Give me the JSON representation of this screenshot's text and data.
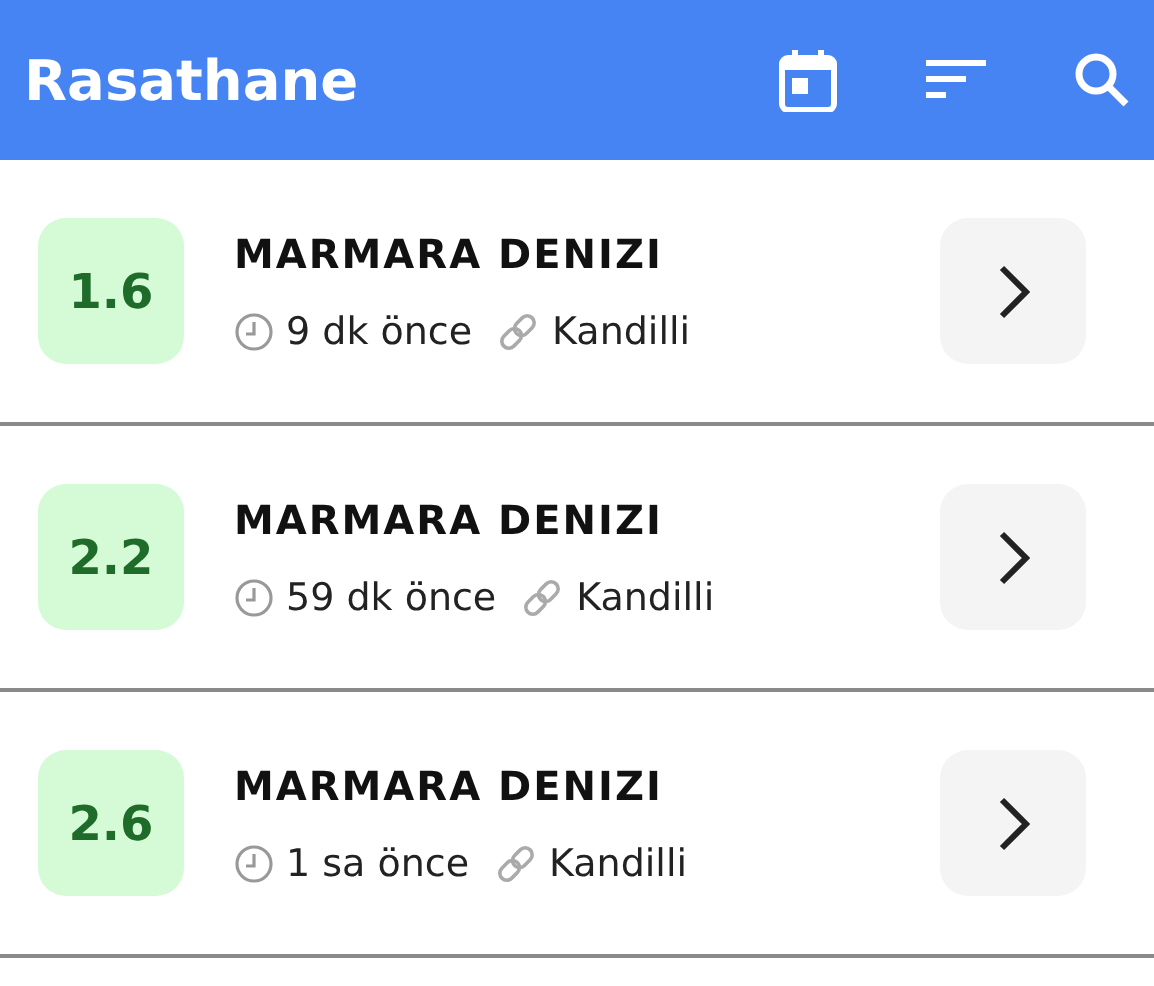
{
  "app_bar": {
    "title": "Rasathane"
  },
  "earthquakes": [
    {
      "magnitude": "1.6",
      "location": "MARMARA DENIZI",
      "time": "9 dk önce",
      "source": "Kandilli"
    },
    {
      "magnitude": "2.2",
      "location": "MARMARA DENIZI",
      "time": "59 dk önce",
      "source": "Kandilli"
    },
    {
      "magnitude": "2.6",
      "location": "MARMARA DENIZI",
      "time": "1 sa önce",
      "source": "Kandilli"
    }
  ]
}
